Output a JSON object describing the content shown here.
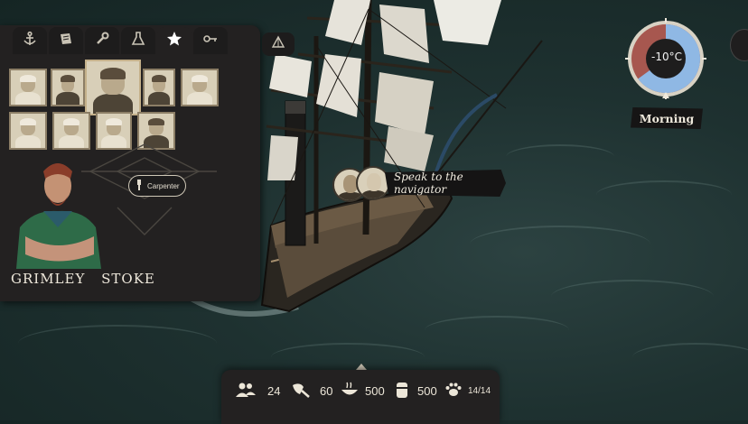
{
  "crew_panel": {
    "tabs": [
      {
        "icon": "anchor-icon"
      },
      {
        "icon": "map-scroll-icon"
      },
      {
        "icon": "wrench-icon"
      },
      {
        "icon": "flask-icon"
      },
      {
        "icon": "star-icon"
      },
      {
        "icon": "key-icon"
      }
    ],
    "nav_icon": "navigation-icon",
    "selected_character": {
      "name": "GRIMLEY STOKE",
      "role": "Carpenter",
      "role_icon": "carpenter-icon"
    }
  },
  "speak": {
    "label": "Speak to the navigator"
  },
  "weather": {
    "temperature": "-10°C",
    "time_of_day": "Morning",
    "cold_fraction": 0.65
  },
  "resources": {
    "crew": {
      "icon": "crew-icon",
      "value": "24"
    },
    "meat": {
      "icon": "meat-icon",
      "value": "60"
    },
    "food": {
      "icon": "food-bowl-icon",
      "value": "500"
    },
    "fuel": {
      "icon": "fuel-barrel-icon",
      "value": "500"
    },
    "animals": {
      "icon": "paw-icon",
      "value": "14/14"
    }
  },
  "colors": {
    "sea": "#1e3130",
    "panel": "#232121",
    "text": "#efe9dc",
    "cold": "#8fb8e4",
    "warm": "#a7574f"
  }
}
